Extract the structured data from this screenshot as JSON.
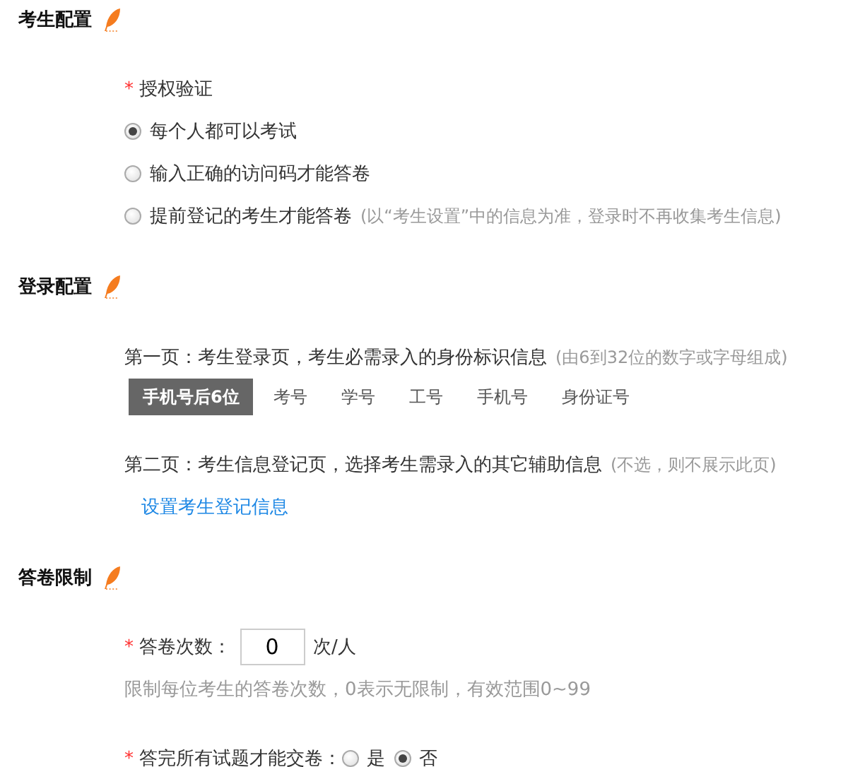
{
  "auth_section": {
    "title": "考生配置",
    "label": "授权验证",
    "required_mark": "*",
    "options": [
      {
        "label": "每个人都可以考试",
        "selected": true
      },
      {
        "label": "输入正确的访问码才能答卷",
        "selected": false
      },
      {
        "label": "提前登记的考生才能答卷",
        "note": "(以“考生设置”中的信息为准，登录时不再收集考生信息)",
        "selected": false
      }
    ]
  },
  "login_section": {
    "title": "登录配置",
    "page1_label": "第一页：考生登录页，考生必需录入的身份标识信息",
    "page1_note": "(由6到32位的数字或字母组成)",
    "id_types": [
      {
        "label": "手机号后6位",
        "selected": true
      },
      {
        "label": "考号",
        "selected": false
      },
      {
        "label": "学号",
        "selected": false
      },
      {
        "label": "工号",
        "selected": false
      },
      {
        "label": "手机号",
        "selected": false
      },
      {
        "label": "身份证号",
        "selected": false
      }
    ],
    "page2_label": "第二页：考生信息登记页，选择考生需录入的其它辅助信息",
    "page2_note": "(不选，则不展示此页)",
    "link": "设置考生登记信息"
  },
  "limit_section": {
    "title": "答卷限制",
    "attempts_label": "答卷次数：",
    "attempts_required_mark": "*",
    "attempts_value": "0",
    "attempts_unit": "次/人",
    "attempts_hint": "限制每位考生的答卷次数，0表示无限制，有效范围0~99",
    "finish_label": "答完所有试题才能交卷：",
    "finish_required_mark": "*",
    "finish_options": [
      {
        "label": "是",
        "selected": false
      },
      {
        "label": "否",
        "selected": true
      }
    ]
  }
}
